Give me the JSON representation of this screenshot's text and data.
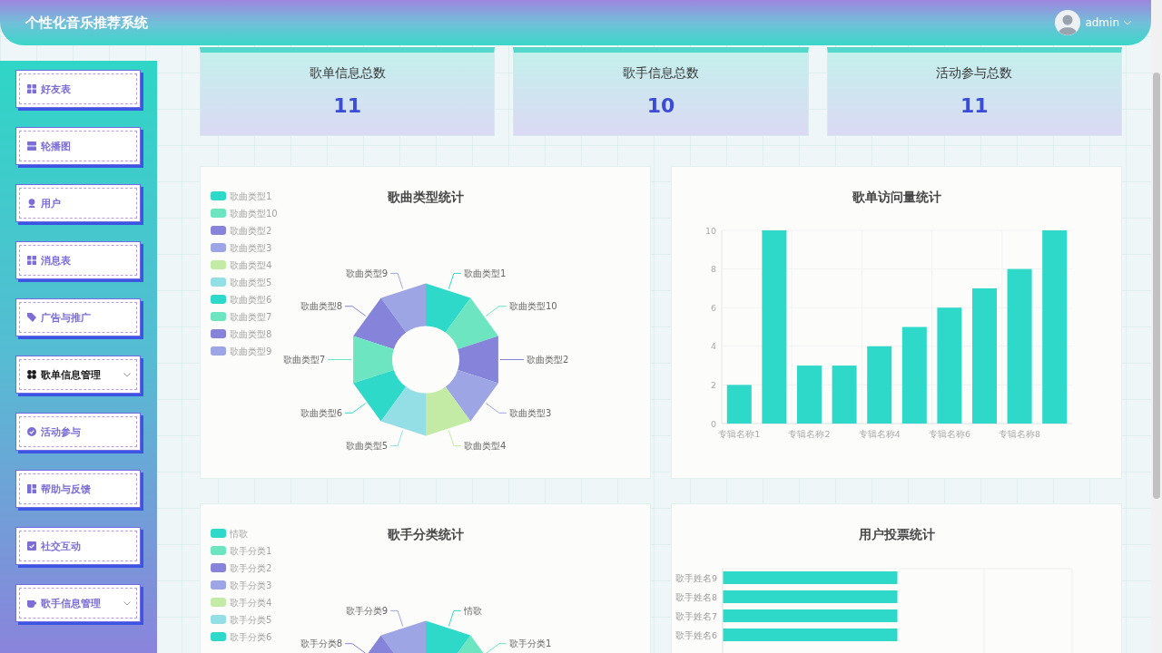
{
  "header": {
    "title": "个性化音乐推荐系统",
    "user": "admin"
  },
  "sidebar": {
    "items": [
      {
        "label": "好友表",
        "kind": "link",
        "selected": false
      },
      {
        "label": "轮播图",
        "kind": "link",
        "selected": false
      },
      {
        "label": "用户",
        "kind": "link",
        "selected": false
      },
      {
        "label": "消息表",
        "kind": "link",
        "selected": false
      },
      {
        "label": "广告与推广",
        "kind": "link",
        "selected": false
      },
      {
        "label": "歌单信息管理",
        "kind": "submenu",
        "selected": true
      },
      {
        "label": "活动参与",
        "kind": "link",
        "selected": false
      },
      {
        "label": "帮助与反馈",
        "kind": "link",
        "selected": false
      },
      {
        "label": "社交互动",
        "kind": "link",
        "selected": false
      },
      {
        "label": "歌手信息管理",
        "kind": "submenu",
        "selected": false
      }
    ]
  },
  "stats": [
    {
      "label": "歌单信息总数",
      "value": "11"
    },
    {
      "label": "歌手信息总数",
      "value": "10"
    },
    {
      "label": "活动参与总数",
      "value": "11"
    }
  ],
  "charts": [
    {
      "kind": "donut",
      "title": "歌曲类型统计",
      "legend": [
        {
          "label": "歌曲类型1",
          "color": "#2ed9c9"
        },
        {
          "label": "歌曲类型10",
          "color": "#6de5c1"
        },
        {
          "label": "歌曲类型2",
          "color": "#8584da"
        },
        {
          "label": "歌曲类型3",
          "color": "#9da5e4"
        },
        {
          "label": "歌曲类型4",
          "color": "#c3eba5"
        },
        {
          "label": "歌曲类型5",
          "color": "#94dfe6"
        },
        {
          "label": "歌曲类型6",
          "color": "#2ed9c9"
        },
        {
          "label": "歌曲类型7",
          "color": "#6de5c1"
        },
        {
          "label": "歌曲类型8",
          "color": "#8584da"
        },
        {
          "label": "歌曲类型9",
          "color": "#9da5e4"
        }
      ],
      "right_slices": [
        {
          "label": "歌曲类型1",
          "color": "#2ed9c9"
        },
        {
          "label": "歌曲类型10",
          "color": "#6de5c1"
        },
        {
          "label": "歌曲类型2",
          "color": "#8584da"
        },
        {
          "label": "歌曲类型3",
          "color": "#9da5e4"
        },
        {
          "label": "歌曲类型4",
          "color": "#c3eba5"
        }
      ],
      "left_slices": [
        {
          "label": "歌曲类型9",
          "color": "#9da5e4"
        },
        {
          "label": "歌曲类型8",
          "color": "#8584da"
        },
        {
          "label": "歌曲类型7",
          "color": "#6de5c1"
        },
        {
          "label": "歌曲类型6",
          "color": "#2ed9c9"
        },
        {
          "label": "歌曲类型5",
          "color": "#94dfe6"
        }
      ]
    },
    {
      "kind": "bar",
      "chart_data": {
        "type": "bar",
        "title": "歌单访问量统计",
        "categories": [
          "专辑名称1",
          null,
          "专辑名称2",
          null,
          "专辑名称4",
          null,
          "专辑名称6",
          null,
          "专辑名称8",
          null
        ],
        "series": [
          {
            "color": "#2ed9c9",
            "values": [
              2,
              10,
              3,
              3,
              4,
              5,
              6,
              7,
              8,
              10
            ]
          }
        ],
        "ylim": [
          0,
          10
        ],
        "yticks": [
          0,
          2,
          4,
          6,
          8,
          10
        ],
        "grid": true
      }
    },
    {
      "kind": "donut",
      "title": "歌手分类统计",
      "legend": [
        {
          "label": "情歌",
          "color": "#2ed9c9"
        },
        {
          "label": "歌手分类1",
          "color": "#6de5c1"
        },
        {
          "label": "歌手分类2",
          "color": "#8584da"
        },
        {
          "label": "歌手分类3",
          "color": "#9da5e4"
        },
        {
          "label": "歌手分类4",
          "color": "#c3eba5"
        },
        {
          "label": "歌手分类5",
          "color": "#94dfe6"
        },
        {
          "label": "歌手分类6",
          "color": "#2ed9c9"
        }
      ],
      "right_slices": [
        {
          "label": "情歌",
          "color": "#2ed9c9"
        },
        {
          "label": "歌手分类1",
          "color": "#6de5c1"
        }
      ],
      "left_slices": [
        {
          "label": "歌手分类9",
          "color": "#9da5e4"
        },
        {
          "label": "歌手分类8",
          "color": "#8584da"
        }
      ]
    },
    {
      "kind": "hbar",
      "title": "用户投票统计",
      "bars": [
        {
          "label": "歌手姓名9"
        },
        {
          "label": "歌手姓名8"
        },
        {
          "label": "歌手姓名7"
        },
        {
          "label": "歌手姓名6"
        }
      ]
    }
  ]
}
